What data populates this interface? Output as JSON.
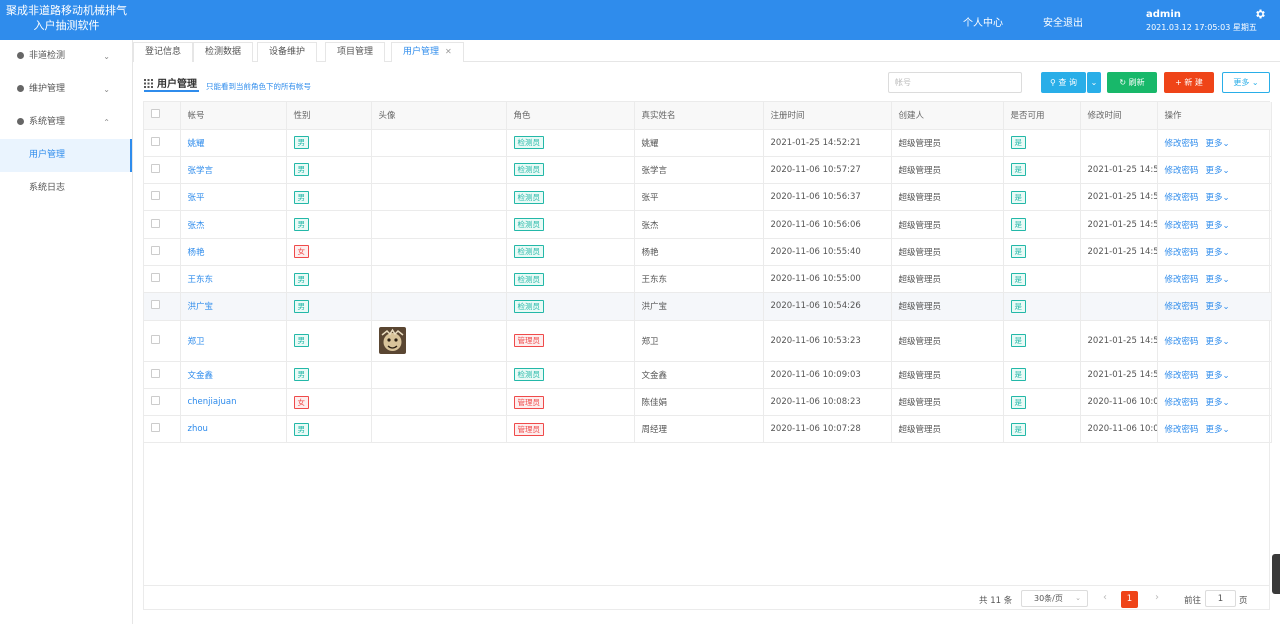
{
  "header": {
    "title_line1": "聚成非道路移动机械排气",
    "title_line2": "入户抽测软件",
    "personal_center": "个人中心",
    "logout": "安全退出",
    "username": "admin",
    "datetime": "2021.03.12 17:05:03 星期五",
    "bg_color": "#2f8cec"
  },
  "sidebar": {
    "menus": [
      {
        "label": "非道检测",
        "icon": "dot-icon",
        "expanded": false
      },
      {
        "label": "维护管理",
        "icon": "dot-icon",
        "expanded": false
      },
      {
        "label": "系统管理",
        "icon": "dot-icon",
        "expanded": true
      }
    ],
    "submenus": [
      {
        "label": "用户管理",
        "active": true
      },
      {
        "label": "系统日志",
        "active": false
      }
    ]
  },
  "tabs": [
    {
      "label": "登记信息"
    },
    {
      "label": "检测数据"
    },
    {
      "label": "设备维护"
    },
    {
      "label": "项目管理"
    },
    {
      "label": "用户管理",
      "active": true,
      "closable": true
    }
  ],
  "toolbar": {
    "title": "用户管理",
    "hint": "只能看到当前角色下的所有帐号",
    "search_placeholder": "帐号",
    "query": "查 询",
    "refresh": "刷新",
    "new": "新 建",
    "more": "更多"
  },
  "table": {
    "columns": [
      "帐号",
      "性别",
      "头像",
      "角色",
      "真实姓名",
      "注册时间",
      "创建人",
      "是否可用",
      "修改时间",
      "操作"
    ],
    "op_change_pwd": "修改密码",
    "op_more": "更多",
    "rows": [
      {
        "account": "姚耀",
        "gender": "男",
        "avatar": false,
        "role": "检测员",
        "name": "姚耀",
        "reg": "2021-01-25 14:52:21",
        "creator": "超级管理员",
        "enabled": "是",
        "modified": ""
      },
      {
        "account": "张学言",
        "gender": "男",
        "avatar": false,
        "role": "检测员",
        "name": "张学言",
        "reg": "2020-11-06 10:57:27",
        "creator": "超级管理员",
        "enabled": "是",
        "modified": "2021-01-25 14:5"
      },
      {
        "account": "张平",
        "gender": "男",
        "avatar": false,
        "role": "检测员",
        "name": "张平",
        "reg": "2020-11-06 10:56:37",
        "creator": "超级管理员",
        "enabled": "是",
        "modified": "2021-01-25 14:5"
      },
      {
        "account": "张杰",
        "gender": "男",
        "avatar": false,
        "role": "检测员",
        "name": "张杰",
        "reg": "2020-11-06 10:56:06",
        "creator": "超级管理员",
        "enabled": "是",
        "modified": "2021-01-25 14:5"
      },
      {
        "account": "杨艳",
        "gender": "女",
        "avatar": false,
        "role": "检测员",
        "name": "杨艳",
        "reg": "2020-11-06 10:55:40",
        "creator": "超级管理员",
        "enabled": "是",
        "modified": "2021-01-25 14:5"
      },
      {
        "account": "王东东",
        "gender": "男",
        "avatar": false,
        "role": "检测员",
        "name": "王东东",
        "reg": "2020-11-06 10:55:00",
        "creator": "超级管理员",
        "enabled": "是",
        "modified": ""
      },
      {
        "account": "洪广宝",
        "gender": "男",
        "avatar": false,
        "role": "检测员",
        "name": "洪广宝",
        "reg": "2020-11-06 10:54:26",
        "creator": "超级管理员",
        "enabled": "是",
        "modified": "",
        "highlight": true
      },
      {
        "account": "郑卫",
        "gender": "男",
        "avatar": true,
        "role": "管理员",
        "name": "郑卫",
        "reg": "2020-11-06 10:53:23",
        "creator": "超级管理员",
        "enabled": "是",
        "modified": "2021-01-25 14:5"
      },
      {
        "account": "文金鑫",
        "gender": "男",
        "avatar": false,
        "role": "检测员",
        "name": "文金鑫",
        "reg": "2020-11-06 10:09:03",
        "creator": "超级管理员",
        "enabled": "是",
        "modified": "2021-01-25 14:5"
      },
      {
        "account": "chenjiajuan",
        "gender": "女",
        "avatar": false,
        "role": "管理员",
        "name": "陈佳娟",
        "reg": "2020-11-06 10:08:23",
        "creator": "超级管理员",
        "enabled": "是",
        "modified": "2020-11-06 10:0"
      },
      {
        "account": "zhou",
        "gender": "男",
        "avatar": false,
        "role": "管理员",
        "name": "周经理",
        "reg": "2020-11-06 10:07:28",
        "creator": "超级管理员",
        "enabled": "是",
        "modified": "2020-11-06 10:0"
      }
    ]
  },
  "pager": {
    "total": "共 11 条",
    "page_size": "30条/页",
    "current": "1",
    "goto": "前往",
    "goto_value": "1",
    "unit": "页"
  }
}
